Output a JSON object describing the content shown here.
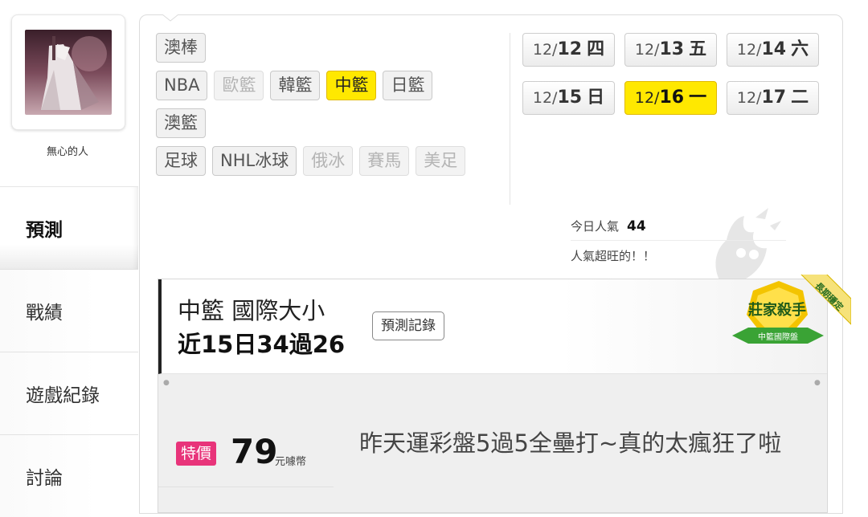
{
  "user": {
    "name": "無心的人"
  },
  "nav": [
    {
      "label": "預測",
      "active": true
    },
    {
      "label": "戰績"
    },
    {
      "label": "遊戲紀錄"
    },
    {
      "label": "討論"
    }
  ],
  "leagues": {
    "row1": [
      {
        "label": "澳棒"
      }
    ],
    "row2": [
      {
        "label": "NBA"
      },
      {
        "label": "歐籃",
        "disabled": true
      },
      {
        "label": "韓籃"
      },
      {
        "label": "中籃",
        "active": true
      },
      {
        "label": "日籃"
      }
    ],
    "row3": [
      {
        "label": "澳籃"
      }
    ],
    "row4": [
      {
        "label": "足球"
      },
      {
        "label": "NHL冰球"
      },
      {
        "label": "俄冰",
        "disabled": true
      },
      {
        "label": "賽馬",
        "disabled": true
      },
      {
        "label": "美足",
        "disabled": true
      }
    ]
  },
  "dates": [
    {
      "month": "12/",
      "day": "12",
      "weekday": "四"
    },
    {
      "month": "12/",
      "day": "13",
      "weekday": "五"
    },
    {
      "month": "12/",
      "day": "14",
      "weekday": "六"
    },
    {
      "month": "12/",
      "day": "15",
      "weekday": "日"
    },
    {
      "month": "12/",
      "day": "16",
      "weekday": "一",
      "active": true
    },
    {
      "month": "12/",
      "day": "17",
      "weekday": "二"
    }
  ],
  "popularity": {
    "label": "今日人氣",
    "value": "44",
    "status": "人氣超旺的！！"
  },
  "card": {
    "title": "中籃 國際大小",
    "stat": "近15日34過26",
    "record_button": "預測記錄",
    "badge": {
      "ribbon": "長期穩定",
      "title": "莊家殺手",
      "subtitle": "中籃國際盤"
    },
    "price_tag": "特價",
    "price": "79",
    "price_unit": "元噱幣",
    "headline": "昨天運彩盤5過5全壘打~真的太瘋狂了啦"
  },
  "colors": {
    "active_yellow": "#ffe800",
    "price_tag_pink": "#e8347a",
    "badge_green": "#3aa335",
    "badge_gold": "#e8b400"
  }
}
